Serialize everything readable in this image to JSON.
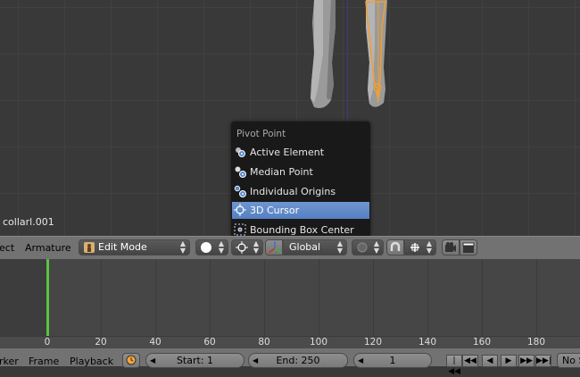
{
  "viewport": {
    "object_name": "collarl.001"
  },
  "pivot_menu": {
    "title": "Pivot Point",
    "items": [
      {
        "label": "Active Element",
        "icon": "active-element-icon"
      },
      {
        "label": "Median Point",
        "icon": "median-point-icon"
      },
      {
        "label": "Individual Origins",
        "icon": "individual-origins-icon"
      },
      {
        "label": "3D Cursor",
        "icon": "3d-cursor-icon",
        "highlighted": true
      },
      {
        "label": "Bounding Box Center",
        "icon": "bounding-box-center-icon"
      }
    ]
  },
  "header": {
    "menu_select": "ect",
    "menu_armature": "Armature",
    "mode": "Edit Mode",
    "orientation": "Global"
  },
  "timeline": {
    "ruler_ticks": [
      "0",
      "20",
      "40",
      "60",
      "80",
      "100",
      "120",
      "140",
      "160",
      "180"
    ],
    "current_frame_marker": 0
  },
  "footer": {
    "menu_marker": "rker",
    "menu_frame": "Frame",
    "menu_playback": "Playback",
    "start_label": "Start: 1",
    "end_label": "End: 250",
    "current_frame": "1",
    "sync_label": "No S"
  },
  "colors": {
    "highlight": "#5680c2",
    "playhead": "#57c442",
    "selection_orange": "#f0a030"
  }
}
